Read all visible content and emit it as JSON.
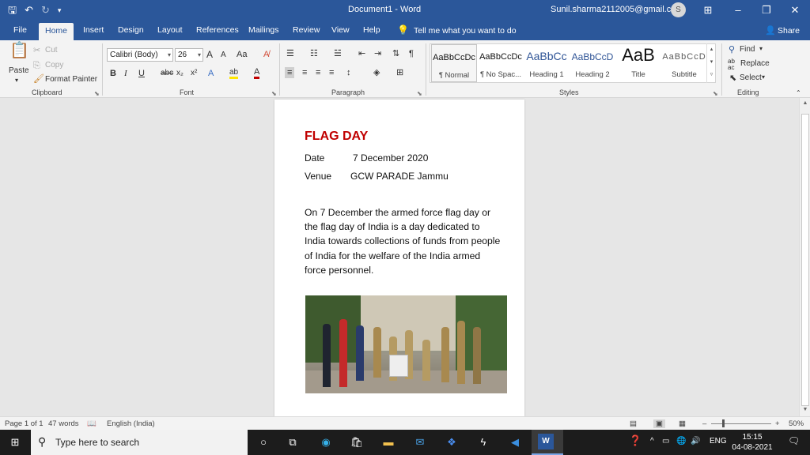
{
  "titlebar": {
    "document_title": "Document1 - Word",
    "user_email": "Sunil.sharma2112005@gmail.com",
    "avatar_initial": "S",
    "save_glyph": "🖫",
    "undo_glyph": "↶",
    "redo_glyph": "↻",
    "customize_glyph": "▾",
    "ribbon_display_glyph": "⊞",
    "minimize_glyph": "–",
    "restore_glyph": "❐",
    "close_glyph": "✕"
  },
  "tabs": [
    "File",
    "Home",
    "Insert",
    "Design",
    "Layout",
    "References",
    "Mailings",
    "Review",
    "View",
    "Help"
  ],
  "active_tab": "Home",
  "tell_me": "Tell me what you want to do",
  "share": "Share",
  "clipboard": {
    "paste": "Paste",
    "cut": "Cut",
    "copy": "Copy",
    "format_painter": "Format Painter",
    "label": "Clipboard"
  },
  "font": {
    "name": "Calibri (Body)",
    "size": "26",
    "label": "Font",
    "grow": "A",
    "shrink": "A",
    "case": "Aa",
    "bold": "B",
    "italic": "I",
    "underline": "U",
    "strike": "abc",
    "subscript": "x₂",
    "superscript": "x²",
    "effects": "A",
    "highlight": "ab",
    "color": "A"
  },
  "paragraph": {
    "label": "Paragraph"
  },
  "styles": {
    "label": "Styles",
    "items": [
      {
        "preview": "AaBbCcDc",
        "name": "¶ Normal"
      },
      {
        "preview": "AaBbCcDc",
        "name": "¶ No Spac..."
      },
      {
        "preview": "AaBbCc",
        "name": "Heading 1"
      },
      {
        "preview": "AaBbCcD",
        "name": "Heading 2"
      },
      {
        "preview": "AaB",
        "name": "Title"
      },
      {
        "preview": "AaBbCcD",
        "name": "Subtitle"
      }
    ]
  },
  "editing": {
    "find": "Find",
    "replace": "Replace",
    "select": "Select",
    "label": "Editing"
  },
  "document": {
    "heading": "FLAG DAY",
    "date_label": "Date",
    "date_value": "7 December 2020",
    "venue_label": "Venue",
    "venue_value": "GCW PARADE Jammu",
    "body": "On 7 December the armed force flag day or the flag day of India is a day dedicated to India towards collections of funds from people of India for the welfare of the India armed force personnel."
  },
  "status": {
    "page": "Page 1 of 1",
    "words": "47 words",
    "language": "English (India)",
    "zoom": "50%"
  },
  "taskbar": {
    "search_placeholder": "Type here to search",
    "language": "ENG",
    "time": "15:15",
    "date": "04-08-2021"
  },
  "colors": {
    "word_blue": "#2b579a",
    "heading_red": "#c00000"
  }
}
